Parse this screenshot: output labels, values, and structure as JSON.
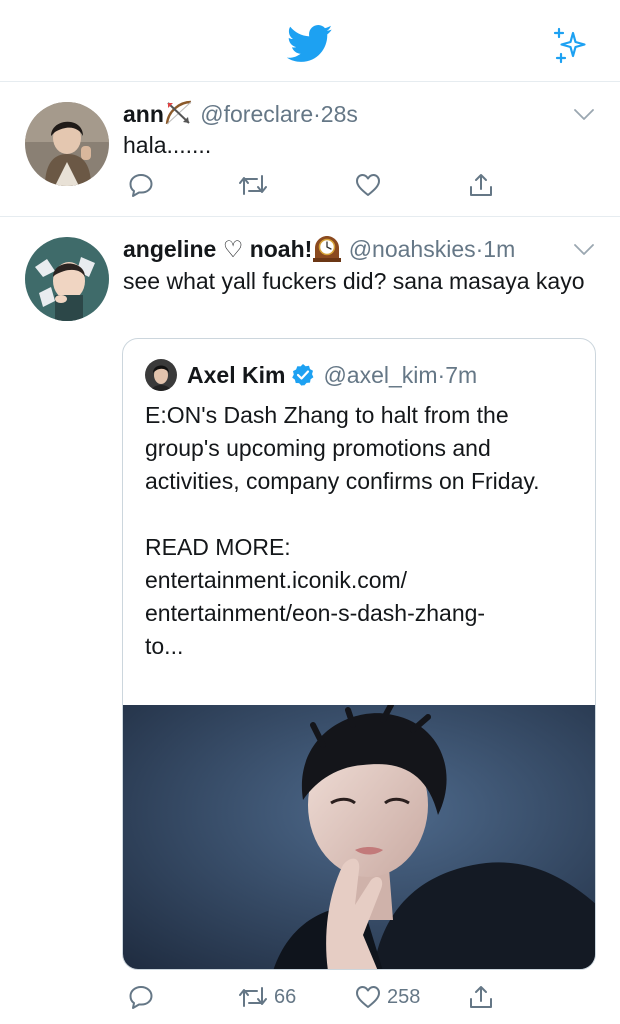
{
  "topbar": {
    "logo_icon": "twitter-bird-icon",
    "sparkle_icon": "sparkle-icon",
    "brand_color": "#1da1f2"
  },
  "tweets": [
    {
      "name": "ann",
      "emoji": "bow-and-arrow",
      "handle": "@foreclare",
      "separator": "·",
      "time": "28s",
      "text": "hala.......",
      "reply_count": "",
      "retweet_count": "",
      "like_count": ""
    },
    {
      "name": "angeline ♡ noah!",
      "emoji": "mantelpiece-clock",
      "handle": "@noahskies",
      "separator": "·",
      "time": "1m",
      "text": "see what yall fuckers did? sana masaya kayo",
      "reply_count": "",
      "retweet_count": "66",
      "like_count": "258",
      "quote": {
        "name": "Axel Kim",
        "handle": "@axel_kim",
        "separator": "·",
        "time": "7m",
        "text": "E:ON's Dash Zhang to halt from the group's upcoming promotions and activities, company confirms on Friday.\n\nREAD MORE:\nentertainment.iconik.com/\nentertainment/eon-s-dash-zhang-\nto..."
      }
    }
  ]
}
